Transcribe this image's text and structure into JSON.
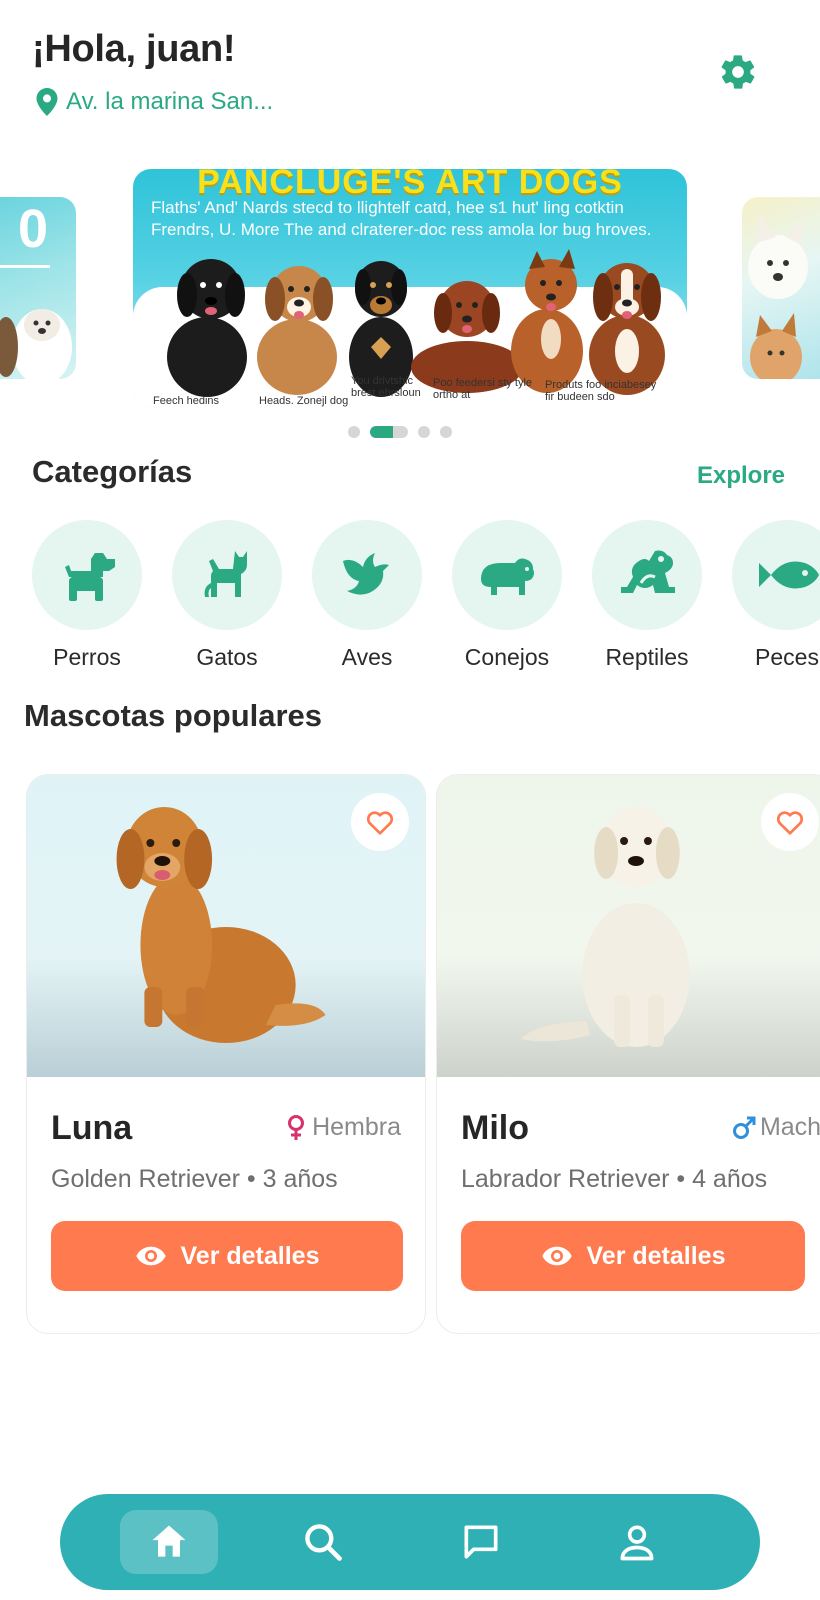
{
  "header": {
    "greeting": "¡Hola, juan!",
    "location": "Av. la marina San...",
    "settings_icon": "gear-icon"
  },
  "carousel": {
    "main_banner": {
      "title": "PANCLUGE'S ART DOGS",
      "text": "Flaths' And' Nards stecd to llightelf catd, hee s1 hut' ling cotktin Frendrs, U. More The and clraterer-doc ress amola lor bug hroves.",
      "captions": [
        "Feech hedins",
        "Heads. Zonejl dog",
        "You drivtshic brest ehrsloun",
        "Poo feedersi sty tyle ortho at",
        "Produts foo inciabesey fir budeen sdo"
      ]
    },
    "slide_count": 4,
    "active_index": 1
  },
  "categories": {
    "title": "Categorías",
    "explore_label": "Explore",
    "items": [
      {
        "label": "Perros",
        "icon": "dog-icon"
      },
      {
        "label": "Gatos",
        "icon": "cat-icon"
      },
      {
        "label": "Aves",
        "icon": "bird-icon"
      },
      {
        "label": "Conejos",
        "icon": "hippo-icon"
      },
      {
        "label": "Reptiles",
        "icon": "frog-icon"
      },
      {
        "label": "Peces",
        "icon": "fish-icon"
      }
    ]
  },
  "popular": {
    "title": "Mascotas populares",
    "pets": [
      {
        "name": "Luna",
        "sex": "Hembra",
        "sex_icon": "female-icon",
        "breed_age": "Golden Retriever • 3 años",
        "button": "Ver detalles"
      },
      {
        "name": "Milo",
        "sex": "Macho",
        "sex_icon": "male-icon",
        "breed_age": "Labrador Retriever • 4 años",
        "button": "Ver detalles"
      }
    ]
  },
  "nav": {
    "items": [
      "home-icon",
      "search-icon",
      "chat-icon",
      "profile-icon"
    ],
    "active": 0
  },
  "colors": {
    "accent_green": "#2aa982",
    "category_bg": "#e5f5ef",
    "button_orange": "#ff7a4f",
    "nav_teal": "#2fb0b4",
    "female_pink": "#d6336c",
    "male_blue": "#2f8fdc"
  }
}
